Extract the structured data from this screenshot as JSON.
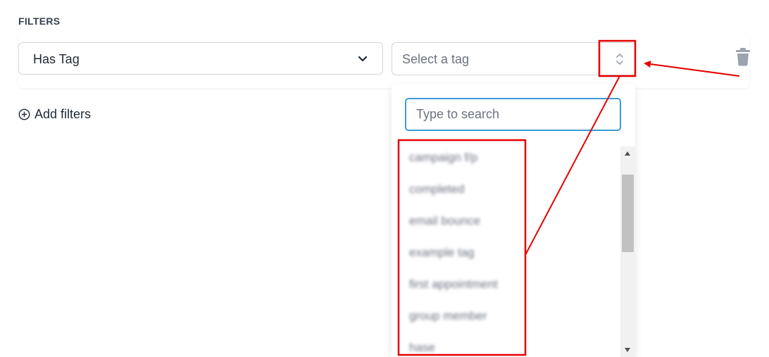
{
  "filters": {
    "section_title": "FILTERS",
    "field_select": {
      "value": "Has Tag",
      "icon": "chevron-down-icon"
    },
    "tag_select": {
      "placeholder": "Select a tag",
      "icon": "up-down-chevron-icon"
    },
    "delete_icon": "trash-icon",
    "add_filters_label": "Add filters",
    "add_filters_icon": "plus-circle-icon"
  },
  "dropdown": {
    "search_placeholder": "Type to search",
    "options": [
      "campaign f/p",
      "completed",
      "email bounce",
      "example tag",
      "first appointment",
      "group member",
      "hase"
    ]
  },
  "annotation": {
    "color": "#e60000"
  }
}
